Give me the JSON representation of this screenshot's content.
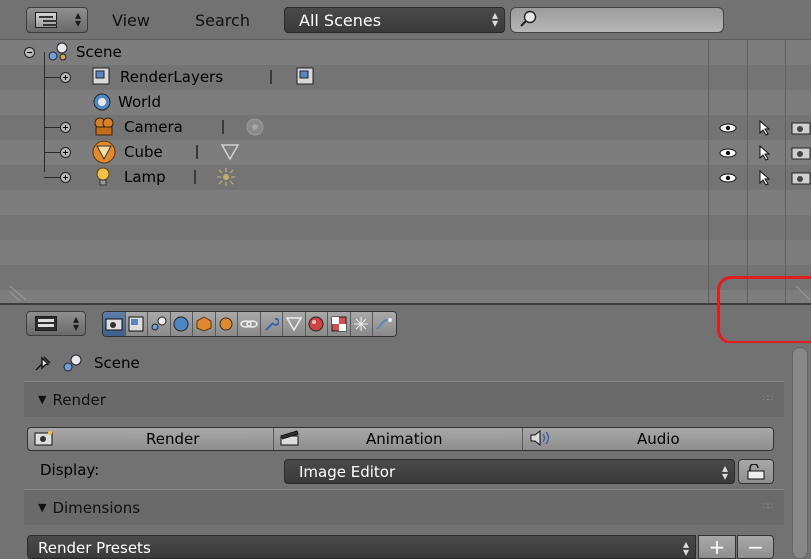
{
  "outliner_header": {
    "view_menu": "View",
    "search_menu": "Search",
    "display_mode": "All Scenes",
    "search_value": ""
  },
  "outliner": {
    "items": [
      {
        "label": "Scene",
        "icon": "scene-icon",
        "expanded": true
      },
      {
        "label": "RenderLayers",
        "icon": "render-layers-icon"
      },
      {
        "label": "World",
        "icon": "world-icon"
      },
      {
        "label": "Camera",
        "icon": "camera-icon"
      },
      {
        "label": "Cube",
        "icon": "mesh-icon"
      },
      {
        "label": "Lamp",
        "icon": "lamp-icon"
      }
    ],
    "restrict_columns": [
      "eye-icon",
      "cursor-icon",
      "render-camera-icon"
    ]
  },
  "properties": {
    "context_tabs": [
      "render",
      "render-layers",
      "scene",
      "world",
      "object",
      "constraints",
      "modifiers",
      "wrench",
      "mesh-data",
      "material",
      "texture",
      "particles",
      "physics"
    ],
    "active_tab": "render",
    "context_path_label": "Scene",
    "render_panel": {
      "title": "Render",
      "render_button": "Render",
      "animation_button": "Animation",
      "audio_button": "Audio",
      "display_label": "Display:",
      "display_value": "Image Editor"
    },
    "dimensions_panel": {
      "title": "Dimensions",
      "presets_label": "Render Presets"
    }
  },
  "colors": {
    "active_tab": "#4f6f9c",
    "highlight_marker": "#e01e1e",
    "dropdown_dark": "#424242"
  }
}
